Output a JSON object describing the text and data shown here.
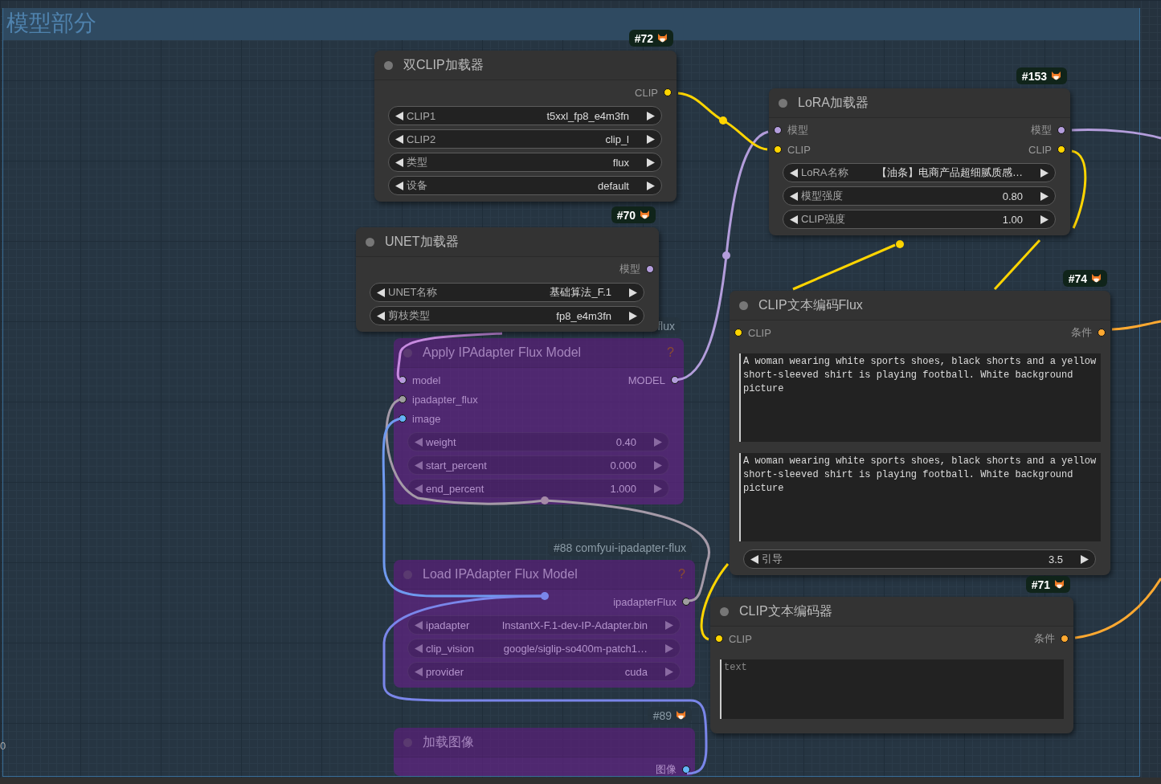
{
  "group": {
    "title": "模型部分"
  },
  "nodes": [
    {
      "badge": {
        "text": "#72",
        "icon": true
      },
      "title": "双CLIP加载器",
      "bypassed": false,
      "outputs": [
        {
          "label": "CLIP",
          "color": "#ffd500"
        }
      ],
      "widgets": [
        {
          "kind": "combo",
          "label": "CLIP1",
          "value": "t5xxl_fp8_e4m3fn"
        },
        {
          "kind": "combo",
          "label": "CLIP2",
          "value": "clip_l"
        },
        {
          "kind": "combo",
          "label": "类型",
          "value": "flux"
        },
        {
          "kind": "combo",
          "label": "设备",
          "value": "default"
        }
      ]
    },
    {
      "badge": {
        "text": "#153",
        "icon": true
      },
      "title": "LoRA加载器",
      "bypassed": false,
      "inputs": [
        {
          "label": "模型",
          "color": "#b39ddb"
        },
        {
          "label": "CLIP",
          "color": "#ffd500"
        }
      ],
      "outputs": [
        {
          "label": "模型",
          "color": "#b39ddb"
        },
        {
          "label": "CLIP",
          "color": "#ffd500"
        }
      ],
      "widgets": [
        {
          "kind": "combo",
          "label": "LoRA名称",
          "value": "【油条】电商产品超细腻质感…"
        },
        {
          "kind": "combo",
          "label": "模型强度",
          "value": "0.80"
        },
        {
          "kind": "combo",
          "label": "CLIP强度",
          "value": "1.00"
        }
      ]
    },
    {
      "badge": {
        "text": "#70",
        "icon": true
      },
      "title": "UNET加载器",
      "bypassed": false,
      "outputs": [
        {
          "label": "模型",
          "color": "#b39ddb"
        }
      ],
      "widgets": [
        {
          "kind": "combo",
          "label": "UNET名称",
          "value": "基础算法_F.1"
        },
        {
          "kind": "combo",
          "label": "剪枝类型",
          "value": "fp8_e4m3fn"
        }
      ]
    },
    {
      "badge": {
        "text": "#74",
        "icon": true
      },
      "title": "CLIP文本编码Flux",
      "bypassed": false,
      "inputs": [
        {
          "label": "CLIP",
          "color": "#ffd500"
        }
      ],
      "outputs": [
        {
          "label": "条件",
          "color": "#ffa931"
        }
      ],
      "widgets": [
        {
          "kind": "text",
          "value": "A woman wearing white sports shoes, black shorts and a yellow short-sleeved shirt is playing football. White background picture"
        },
        {
          "kind": "text",
          "value": "A woman wearing white sports shoes, black shorts and a yellow short-sleeved shirt is playing football. White background picture"
        },
        {
          "kind": "combo",
          "label": "引导",
          "value": "3.5"
        }
      ]
    },
    {
      "badge": {
        "text": "flux",
        "icon": false
      },
      "title": "Apply IPAdapter Flux Model",
      "bypassed": true,
      "help": "?",
      "inputs": [
        {
          "label": "model",
          "color": "#b39ddb"
        },
        {
          "label": "ipadapter_flux",
          "color": "#9e9e9e"
        },
        {
          "label": "image",
          "color": "#64b5f6"
        }
      ],
      "outputs": [
        {
          "label": "MODEL",
          "color": "#b39ddb"
        }
      ],
      "widgets": [
        {
          "kind": "combo",
          "label": "weight",
          "value": "0.40"
        },
        {
          "kind": "combo",
          "label": "start_percent",
          "value": "0.000"
        },
        {
          "kind": "combo",
          "label": "end_percent",
          "value": "1.000"
        }
      ]
    },
    {
      "badge": {
        "text": "#71",
        "icon": true
      },
      "title": "CLIP文本编码器",
      "bypassed": false,
      "inputs": [
        {
          "label": "CLIP",
          "color": "#ffd500"
        }
      ],
      "outputs": [
        {
          "label": "条件",
          "color": "#ffa931"
        }
      ],
      "widgets": [
        {
          "kind": "text",
          "placeholder": "text"
        }
      ]
    },
    {
      "badge": {
        "text": "#88 comfyui-ipadapter-flux",
        "icon": false
      },
      "title": "Load IPAdapter Flux Model",
      "bypassed": true,
      "help": "?",
      "outputs": [
        {
          "label": "ipadapterFlux",
          "color": "#9e9e9e"
        }
      ],
      "widgets": [
        {
          "kind": "combo",
          "label": "ipadapter",
          "value": "InstantX-F.1-dev-IP-Adapter.bin"
        },
        {
          "kind": "combo",
          "label": "clip_vision",
          "value": "google/siglip-so400m-patch1…"
        },
        {
          "kind": "combo",
          "label": "provider",
          "value": "cuda"
        }
      ]
    },
    {
      "badge": {
        "text": "#89",
        "icon": true
      },
      "title": "加载图像",
      "bypassed": true,
      "outputs": [
        {
          "label": "图像",
          "color": "#64b5f6"
        }
      ]
    }
  ],
  "edge_label": "0"
}
